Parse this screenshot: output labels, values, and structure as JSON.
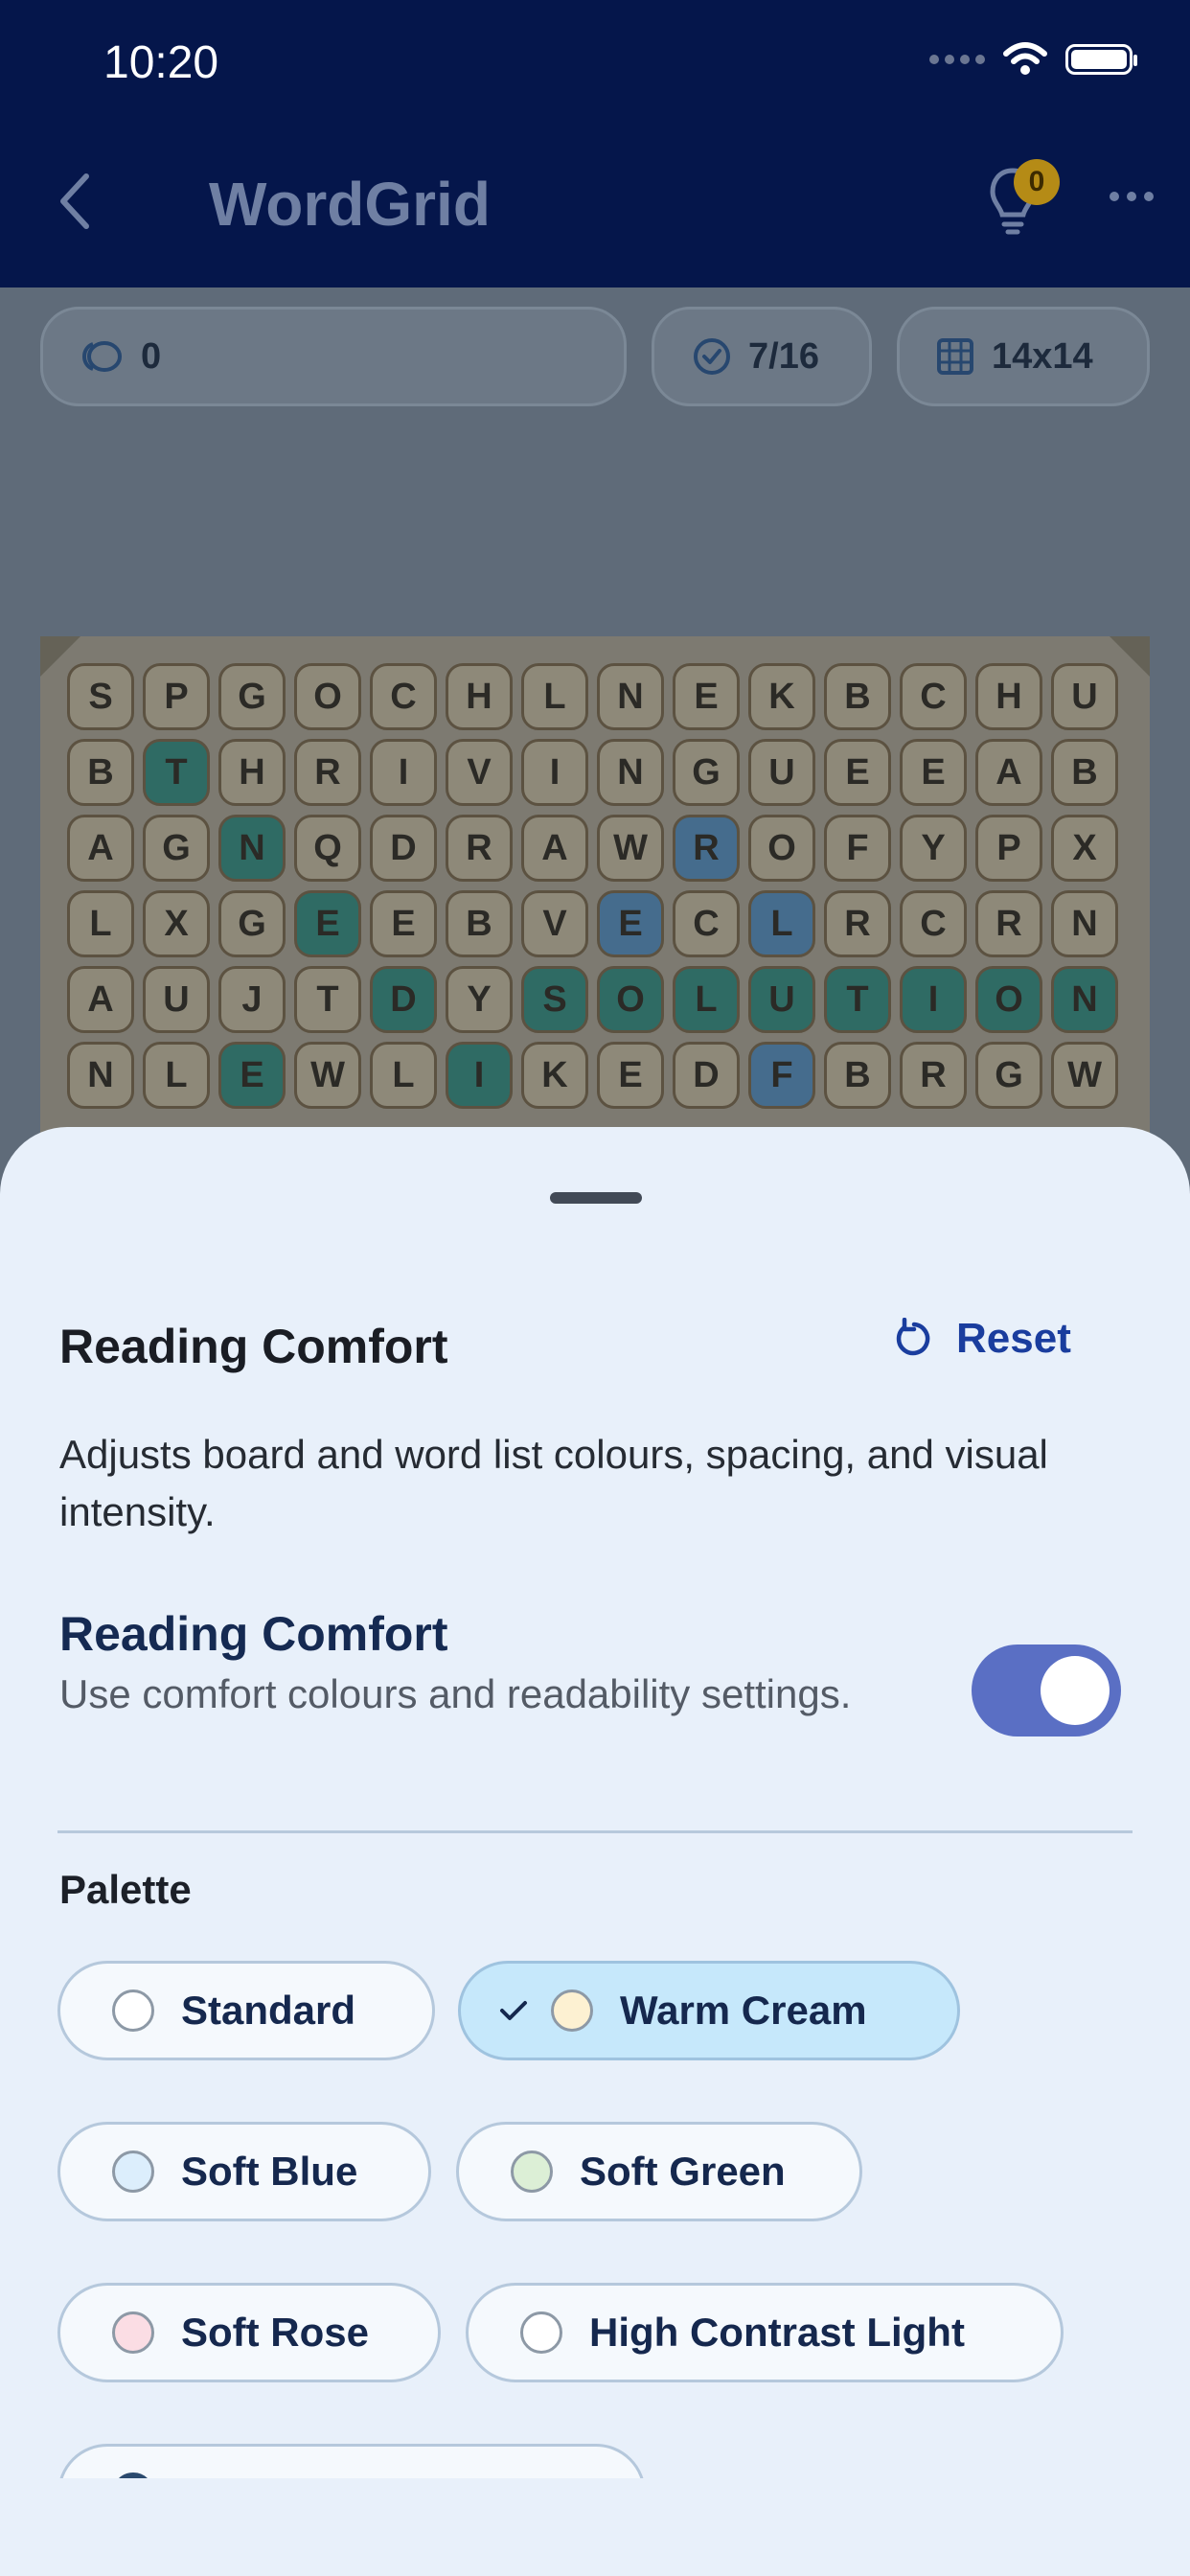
{
  "status": {
    "time": "10:20"
  },
  "header": {
    "title": "WordGrid",
    "hint_count": "0"
  },
  "stats": {
    "score": "0",
    "found": "7/16",
    "size": "14x14"
  },
  "board": {
    "rows": [
      "SPGOCHLNEKBCHU",
      "BTHRIVINGUEEAB",
      "AGNQDRAWROFYPX",
      "LXGEEBVECLRCRN",
      "AUJTDYSOLUTION",
      "NLEWLIKEDFBRGW"
    ],
    "highlight_green": [
      [
        1,
        1
      ],
      [
        2,
        2
      ],
      [
        3,
        3
      ],
      [
        4,
        4
      ],
      [
        5,
        5
      ],
      [
        4,
        6
      ],
      [
        4,
        7
      ],
      [
        4,
        8
      ],
      [
        4,
        9
      ],
      [
        4,
        10
      ],
      [
        4,
        11
      ],
      [
        4,
        12
      ],
      [
        4,
        13
      ],
      [
        5,
        2
      ]
    ],
    "highlight_blue": [
      [
        2,
        8
      ],
      [
        3,
        7
      ],
      [
        3,
        9
      ],
      [
        5,
        9
      ]
    ]
  },
  "sheet": {
    "title": "Reading Comfort",
    "reset_label": "Reset",
    "description": "Adjusts board and word list colours, spacing, and visual intensity.",
    "toggle_title": "Reading Comfort",
    "toggle_subtitle": "Use comfort colours and readability settings.",
    "toggle_on": true,
    "palette_label": "Palette",
    "palettes": [
      {
        "label": "Standard",
        "swatch": "#ffffff",
        "selected": false
      },
      {
        "label": "Warm Cream",
        "swatch": "#fdf1d2",
        "selected": true
      },
      {
        "label": "Soft Blue",
        "swatch": "#dceefc",
        "selected": false
      },
      {
        "label": "Soft Green",
        "swatch": "#dcefd6",
        "selected": false
      },
      {
        "label": "Soft Rose",
        "swatch": "#fbdde4",
        "selected": false
      },
      {
        "label": "High Contrast Light",
        "swatch": "#ffffff",
        "selected": false
      }
    ]
  }
}
